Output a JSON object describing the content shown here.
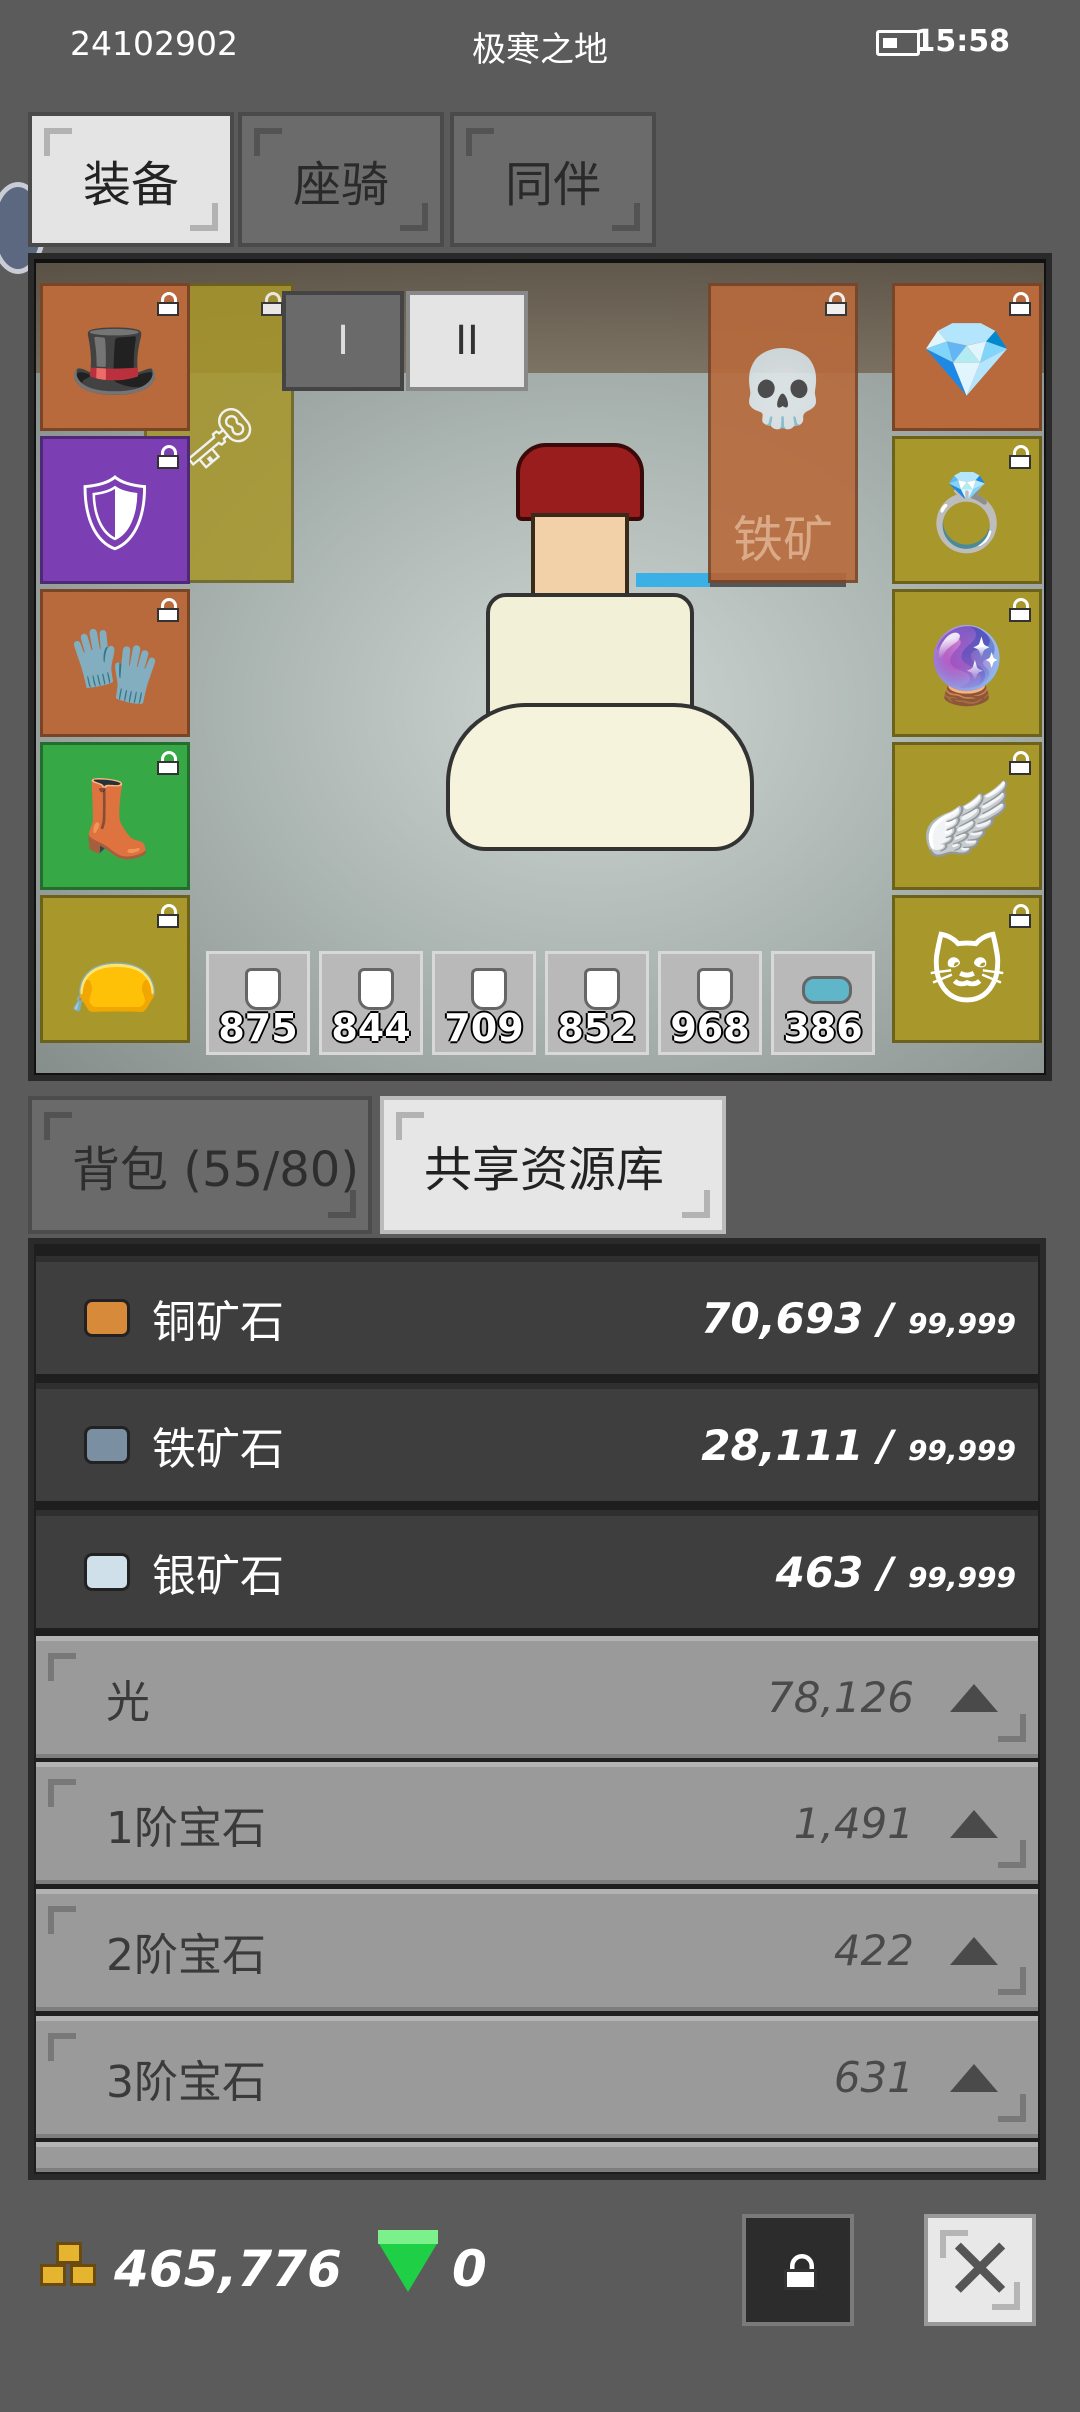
{
  "status_bar": {
    "device_id": "24102902",
    "location": "极寒之地",
    "time": "15:58"
  },
  "top_tabs": [
    {
      "label": "装备",
      "active": true
    },
    {
      "label": "座骑",
      "active": false
    },
    {
      "label": "同伴",
      "active": false
    }
  ],
  "page_switch": [
    "I",
    "II"
  ],
  "equipment": {
    "left": [
      {
        "name": "hat",
        "icon": "red-hat-icon",
        "color": "#b86a3c"
      },
      {
        "name": "armor",
        "icon": "armor-icon",
        "color": "#7b3fb3"
      },
      {
        "name": "gloves",
        "icon": "glove-icon",
        "color": "#b86a3c"
      },
      {
        "name": "boots",
        "icon": "boots-icon",
        "color": "#36a845"
      },
      {
        "name": "belt",
        "icon": "belt-icon",
        "color": "#a8972b"
      }
    ],
    "right": [
      {
        "name": "necklace",
        "icon": "blue-gem-icon",
        "color": "#b86a3c"
      },
      {
        "name": "ring1",
        "icon": "ring-icon",
        "color": "#a8972b"
      },
      {
        "name": "ring2",
        "icon": "purple-ring-icon",
        "color": "#a8972b"
      },
      {
        "name": "charm",
        "icon": "wing-icon",
        "color": "#a8972b"
      },
      {
        "name": "pet",
        "icon": "lucky-cat-icon",
        "color": "#a8972b"
      }
    ],
    "weapon": {
      "icon": "staff-icon",
      "color": "#a8972b"
    },
    "companion": {
      "icon": "skeleton-icon",
      "color": "#b86a3c",
      "overlay_text": "铁矿"
    },
    "potions": [
      "875",
      "844",
      "709",
      "852",
      "968",
      "386"
    ]
  },
  "inventory_tabs": [
    {
      "label": "背包 (55/80)",
      "active": false
    },
    {
      "label": "共享资源库",
      "active": true
    }
  ],
  "resources": [
    {
      "name": "铜矿石",
      "amount": "70,693 / ",
      "max": "99,999",
      "color": "#d68a3a"
    },
    {
      "name": "铁矿石",
      "amount": "28,111 / ",
      "max": "99,999",
      "color": "#7b8fa3"
    },
    {
      "name": "银矿石",
      "amount": "463 / ",
      "max": "99,999",
      "color": "#cfe0ea"
    }
  ],
  "collapsed_groups": [
    {
      "name": "光",
      "amount": "78,126"
    },
    {
      "name": "1阶宝石",
      "amount": "1,491"
    },
    {
      "name": "2阶宝石",
      "amount": "422"
    },
    {
      "name": "3阶宝石",
      "amount": "631"
    }
  ],
  "bottom_bar": {
    "gold": "465,776",
    "gems": "0"
  }
}
